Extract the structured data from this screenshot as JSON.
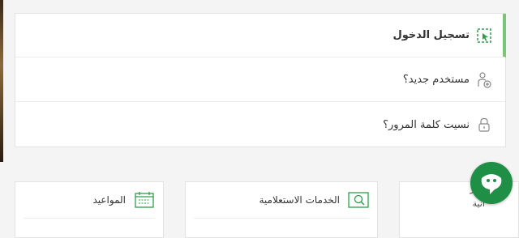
{
  "menu": {
    "login": "تسجيل الدخول",
    "new_user": "مستخدم جديد؟",
    "forgot_password": "نسيت كلمة المرور؟"
  },
  "cards": {
    "appointments": "المواعيد",
    "inquiry_services": "الخدمات الاستعلامية",
    "partial_line1": "\"اٍلاثر",
    "partial_line2": "\"انية"
  },
  "colors": {
    "accent": "#7cc576",
    "icon_green": "#2e9e4a",
    "badge": "#1f8f46"
  }
}
